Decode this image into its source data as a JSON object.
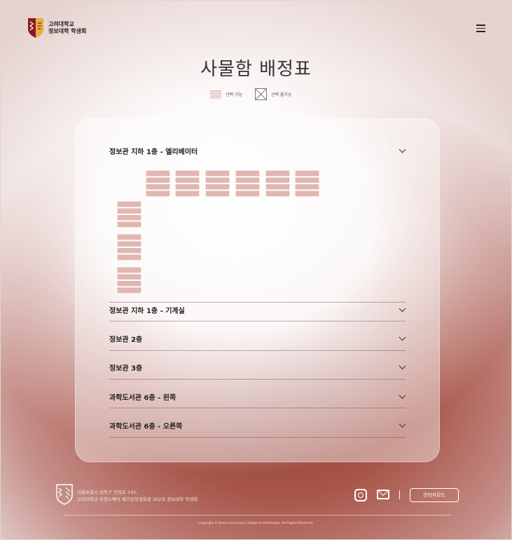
{
  "header": {
    "logo_line1": "고려대학교",
    "logo_line2": "정보대학 학생회"
  },
  "page_title": "사물함 배정표",
  "legend": {
    "available": "선택 가능",
    "unavailable": "선택 불가능"
  },
  "sections": [
    {
      "label": "정보관 지하 1층 - 엘리베이터",
      "expanded": true
    },
    {
      "label": "정보관 지하 1층 - 기계실",
      "expanded": false
    },
    {
      "label": "정보관 2층",
      "expanded": false
    },
    {
      "label": "정보관 3층",
      "expanded": false
    },
    {
      "label": "과학도서관 6층 - 왼쪽",
      "expanded": false
    },
    {
      "label": "과학도서관 6층 - 오른쪽",
      "expanded": false
    }
  ],
  "footer": {
    "address_line1": "서울특별시 성북구 안암로 145,",
    "address_line2": "고려대학교 송현스퀘어 애기능학생회관 302호 정보대학 학생회",
    "admin_button": "관리자모드",
    "copyright": "copyright © Korea University College of Informatics. All Rights Reserved."
  },
  "colors": {
    "brand_red": "#8b1a24",
    "shield_gold": "#e2b13c",
    "locker_fill": "#e8c6c2"
  }
}
